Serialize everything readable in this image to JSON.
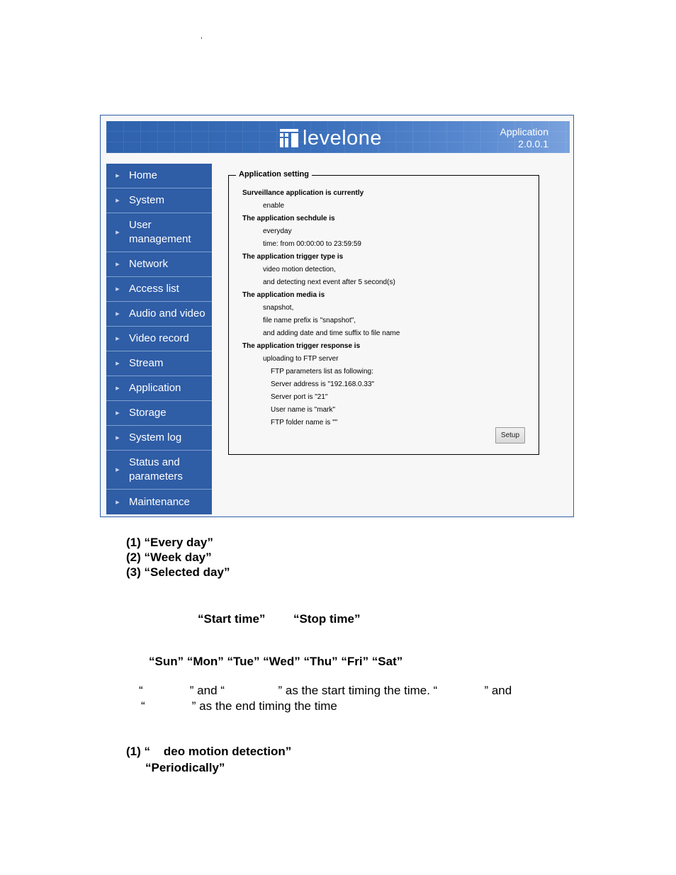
{
  "stray_mark": "’",
  "banner": {
    "brand": "levelone",
    "section": "Application",
    "version": "2.0.0.1",
    "colors": {
      "banner": "#2f62ad",
      "sidebar": "#2f5da6",
      "frame_border": "#2f5fa8"
    }
  },
  "sidebar": {
    "items": [
      {
        "label": "Home",
        "lines": 1
      },
      {
        "label": "System",
        "lines": 1
      },
      {
        "label": "User management",
        "line1": "User",
        "line2": "management",
        "lines": 2
      },
      {
        "label": "Network",
        "lines": 1
      },
      {
        "label": "Access list",
        "lines": 1
      },
      {
        "label": "Audio and video",
        "lines": 1
      },
      {
        "label": "Video record",
        "lines": 1
      },
      {
        "label": "Stream",
        "lines": 1
      },
      {
        "label": "Application",
        "lines": 1
      },
      {
        "label": "Storage",
        "lines": 1
      },
      {
        "label": "System log",
        "lines": 1
      },
      {
        "label": "Status and parameters",
        "line1": "Status and",
        "line2": "parameters",
        "lines": 2
      },
      {
        "label": "Maintenance",
        "lines": 1
      }
    ]
  },
  "settings": {
    "legend": "Application setting",
    "lines": [
      {
        "text": "Surveillance application is currently",
        "level": "head"
      },
      {
        "text": "enable",
        "level": "i1"
      },
      {
        "text": "The application sechdule is",
        "level": "head"
      },
      {
        "text": "everyday",
        "level": "i1"
      },
      {
        "text": "time: from 00:00:00 to 23:59:59",
        "level": "i1"
      },
      {
        "text": "The application trigger type is",
        "level": "head"
      },
      {
        "text": "video motion detection,",
        "level": "i1"
      },
      {
        "text": "and detecting next event after 5 second(s)",
        "level": "i1"
      },
      {
        "text": "The application media is",
        "level": "head"
      },
      {
        "text": "snapshot,",
        "level": "i1"
      },
      {
        "text": "file name prefix is \"snapshot\",",
        "level": "i1"
      },
      {
        "text": "and adding date and time suffix to file name",
        "level": "i1"
      },
      {
        "text": "The application trigger response is",
        "level": "head"
      },
      {
        "text": "uploading to FTP server",
        "level": "i1"
      },
      {
        "text": "FTP parameters list as following:",
        "level": "i2"
      },
      {
        "text": "Server address is \"192.168.0.33\"",
        "level": "i2"
      },
      {
        "text": "Server port is \"21\"",
        "level": "i2"
      },
      {
        "text": "User name is \"mark\"",
        "level": "i2"
      },
      {
        "text": "FTP folder name is \"\"",
        "level": "i2"
      }
    ],
    "setup_button": "Setup"
  },
  "doc": {
    "schedule_options": [
      "(1) “Every day”",
      "(2) “Week day”",
      "(3) “Selected day”"
    ],
    "start_time": "“Start time”",
    "stop_time": "“Stop time”",
    "weekdays": "“Sun” “Mon” “Tue” “Wed” “Thu” “Fri” “Sat”",
    "timing_line1": "“              ” and “                ” as the start timing the time. “              ” and",
    "timing_line2": "“              ” as the end timing the time",
    "trigger_option1": "(1) “    deo motion detection”",
    "trigger_option2": "“Periodically”"
  }
}
